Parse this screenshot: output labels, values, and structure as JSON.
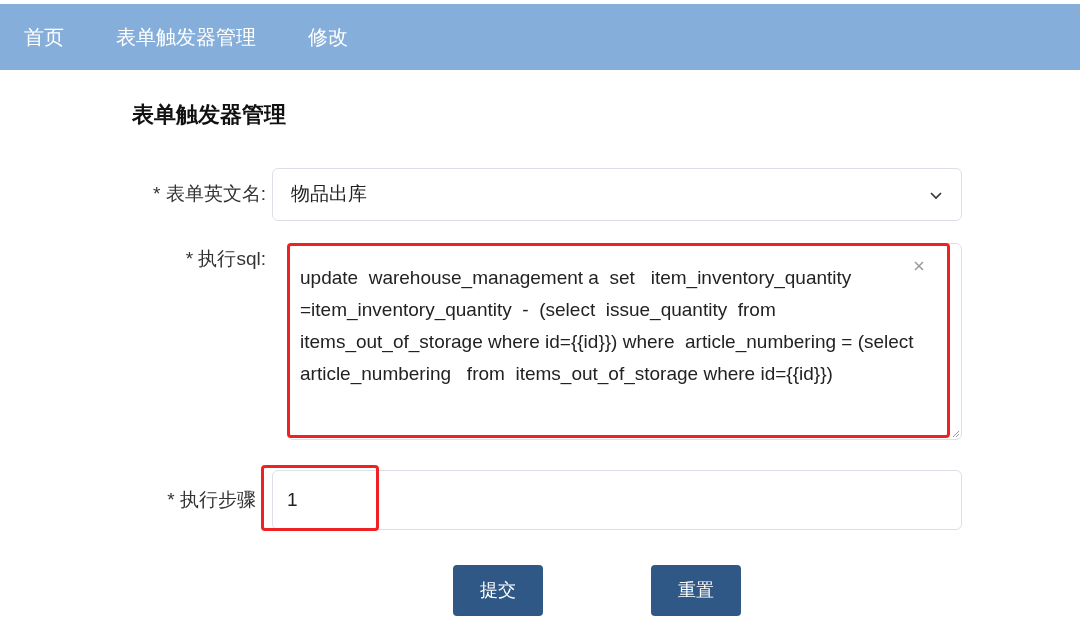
{
  "nav": [
    {
      "label": "首页"
    },
    {
      "label": "表单触发器管理"
    },
    {
      "label": "修改"
    }
  ],
  "title": "表单触发器管理",
  "fields": [
    {
      "kind": "select",
      "label": "* 表单英文名:",
      "value": "物品出库",
      "highlighted": false
    },
    {
      "kind": "textarea",
      "label": "* 执行sql:",
      "value": "update  warehouse_management a  set   item_inventory_quantity =item_inventory_quantity  -  (select  issue_quantity  from items_out_of_storage where id={{id}}) where  article_numbering = (select article_numbering   from  items_out_of_storage where id={{id}})",
      "highlighted": true
    },
    {
      "kind": "input",
      "label": "* 执行步骤",
      "value": "1",
      "highlighted": true
    }
  ],
  "buttons": [
    {
      "label": "提交"
    },
    {
      "label": "重置"
    }
  ]
}
